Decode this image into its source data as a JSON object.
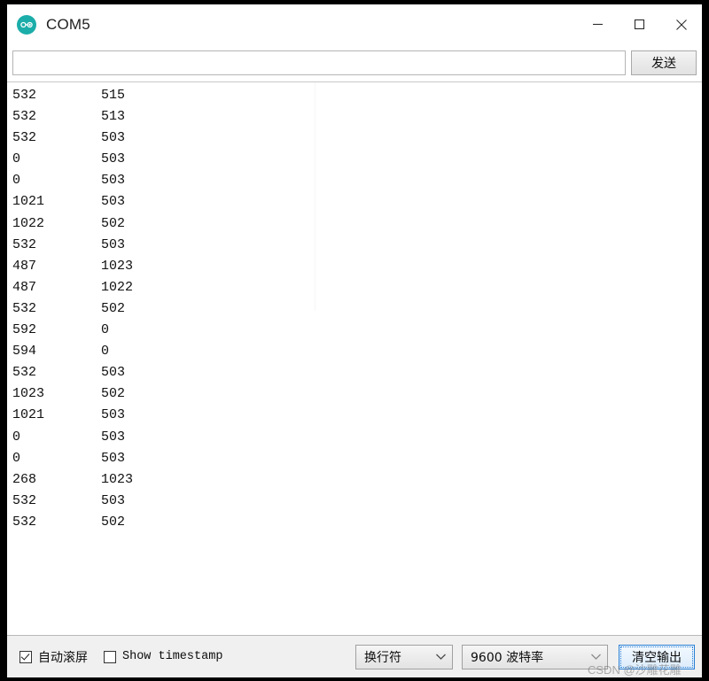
{
  "window": {
    "title": "COM5",
    "icon": "arduino-logo-icon",
    "accent_teal": "#1bada9",
    "controls": {
      "minimize": "minimize-icon",
      "maximize": "maximize-icon",
      "close": "close-icon"
    }
  },
  "send_row": {
    "input_value": "",
    "input_placeholder": "",
    "send_label": "发送"
  },
  "output": {
    "columns": 2,
    "lines": [
      [
        "532",
        "515"
      ],
      [
        "532",
        "513"
      ],
      [
        "532",
        "503"
      ],
      [
        "0",
        "503"
      ],
      [
        "0",
        "503"
      ],
      [
        "1021",
        "503"
      ],
      [
        "1022",
        "502"
      ],
      [
        "532",
        "503"
      ],
      [
        "487",
        "1023"
      ],
      [
        "487",
        "1022"
      ],
      [
        "532",
        "502"
      ],
      [
        "592",
        "0"
      ],
      [
        "594",
        "0"
      ],
      [
        "532",
        "503"
      ],
      [
        "1023",
        "502"
      ],
      [
        "1021",
        "503"
      ],
      [
        "0",
        "503"
      ],
      [
        "0",
        "503"
      ],
      [
        "268",
        "1023"
      ],
      [
        "532",
        "503"
      ],
      [
        "532",
        "502"
      ]
    ]
  },
  "bottom_bar": {
    "autoscroll_label": "自动滚屏",
    "autoscroll_checked": true,
    "timestamp_label": "Show timestamp",
    "timestamp_checked": false,
    "newline_value": "换行符",
    "baud_value": "9600 波特率",
    "clear_label": "清空输出",
    "clear_focus_color": "#2a7fd4"
  },
  "watermark": {
    "text": "CSDN @沙雕花雕"
  }
}
